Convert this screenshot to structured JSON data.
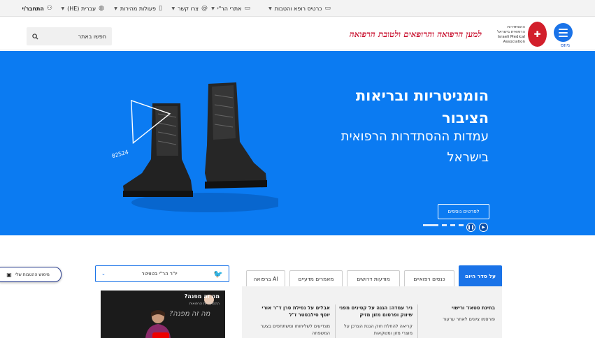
{
  "topbar": {
    "items": [
      {
        "label": "כרטיס רופא והטבות",
        "icon": "id-card-icon"
      },
      {
        "label": "אתרי הר\"י",
        "icon": "laptop-icon"
      },
      {
        "label": "צרו קשר",
        "icon": "at-icon"
      },
      {
        "label": "פעולות מהירות",
        "icon": "document-icon"
      },
      {
        "label": "עברית (HE)",
        "icon": "globe-icon"
      },
      {
        "label": "התחבר/י",
        "icon": "user-icon"
      }
    ]
  },
  "header": {
    "news_label": "ניוזס",
    "logo_text_he": "ההסתדרות הרפואית בישראל",
    "logo_text_en": "Israeli Medical Association",
    "tagline": "למען הרפואה והרופאים ולטובת הרפואה",
    "search_label": "חפשו באתר"
  },
  "hero": {
    "title": "הומניטריות ובריאות הציבור",
    "subtitle": "עמדות ההסתדרות הרפואית בישראל",
    "cta": "לפרטים נוספים",
    "stamp_text": "02524",
    "slides_total": 4,
    "active_slide": 1
  },
  "benefits_button": "מימוש ההטבות שלי",
  "twitter": {
    "select_label": "יו\"ר הר\"י בטוויטר",
    "video_title": "מה זה מפנה?",
    "video_sub": "ההסתדרות הרפואית",
    "video_overlay": "מה זה מפנה?"
  },
  "tabs": {
    "items": [
      "על סדר היום",
      "כנסים רפואיים",
      "מודעות דרושים",
      "מאמרים מדעיים",
      "AI ברפואה"
    ],
    "active": 0
  },
  "news": [
    {
      "title": "בחינת סטאז' ורישוי",
      "body": "פורסמו ציונים לאחר ערעור"
    },
    {
      "title": "ניר עמדה: הגנה על קטינים מפני שיווק ופרסום מזון מזיק",
      "body": "קריאה להחלת חוק הגנת הצרכן על מוצרי מזון ומשקאות"
    },
    {
      "title": "אבלים על נפילת סרן ד\"ר אורי יוסף סילבסטר ז\"ל",
      "body": "מצדיעים לשליחותו ומשתתפים בצער המשפחה"
    }
  ]
}
